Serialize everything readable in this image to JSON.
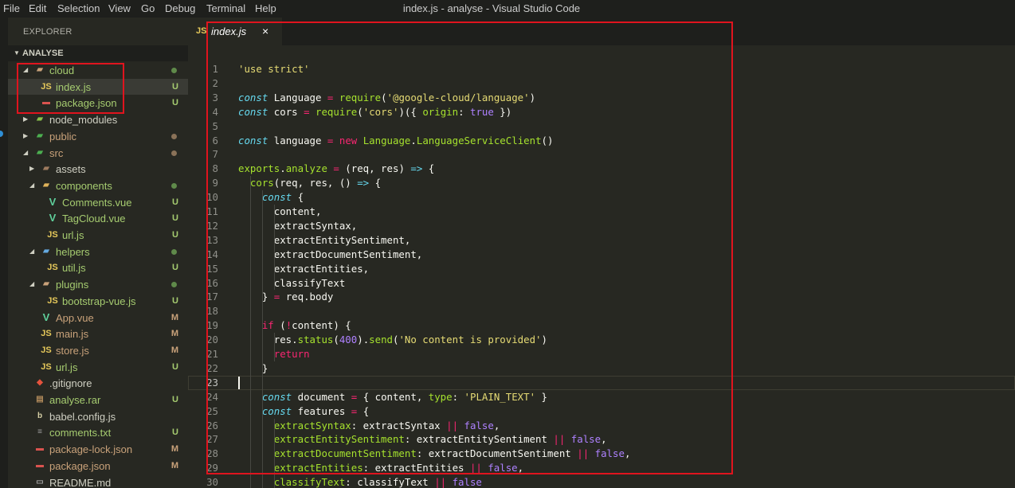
{
  "window": {
    "title": "index.js - analyse - Visual Studio Code"
  },
  "menu": [
    "File",
    "Edit",
    "Selection",
    "View",
    "Go",
    "Debug",
    "Terminal",
    "Help"
  ],
  "sidebar": {
    "title": "EXPLORER",
    "section": "ANALYSE",
    "tree": [
      {
        "name": "cloud",
        "kind": "folder",
        "depth": 1,
        "expanded": true,
        "icon": "folder-open-icon",
        "status": "dot",
        "color": "green"
      },
      {
        "name": "index.js",
        "kind": "js",
        "depth": 2,
        "icon": "js-file-icon",
        "status": "U",
        "color": "green",
        "selected": true
      },
      {
        "name": "package.json",
        "kind": "json",
        "depth": 2,
        "icon": "npm-file-icon",
        "status": "U",
        "color": "green"
      },
      {
        "name": "node_modules",
        "kind": "folder",
        "depth": 1,
        "expanded": false,
        "icon": "node-folder-icon",
        "status": "",
        "color": "white"
      },
      {
        "name": "public",
        "kind": "folder",
        "depth": 1,
        "expanded": false,
        "icon": "public-folder-icon",
        "status": "dot",
        "color": "brown"
      },
      {
        "name": "src",
        "kind": "folder",
        "depth": 1,
        "expanded": true,
        "icon": "src-folder-icon",
        "status": "dot",
        "color": "brown"
      },
      {
        "name": "assets",
        "kind": "folder",
        "depth": 2,
        "expanded": false,
        "icon": "assets-folder-icon",
        "status": "",
        "color": "white"
      },
      {
        "name": "components",
        "kind": "folder",
        "depth": 2,
        "expanded": true,
        "icon": "folder-open-icon",
        "status": "dot",
        "color": "green"
      },
      {
        "name": "Comments.vue",
        "kind": "vue",
        "depth": 3,
        "icon": "vue-file-icon",
        "status": "U",
        "color": "green"
      },
      {
        "name": "TagCloud.vue",
        "kind": "vue",
        "depth": 3,
        "icon": "vue-file-icon",
        "status": "U",
        "color": "green"
      },
      {
        "name": "url.js",
        "kind": "js",
        "depth": 3,
        "icon": "js-file-icon",
        "status": "U",
        "color": "green"
      },
      {
        "name": "helpers",
        "kind": "folder",
        "depth": 2,
        "expanded": true,
        "icon": "helpers-folder-icon",
        "status": "dot",
        "color": "green"
      },
      {
        "name": "util.js",
        "kind": "js",
        "depth": 3,
        "icon": "js-file-icon",
        "status": "U",
        "color": "green"
      },
      {
        "name": "plugins",
        "kind": "folder",
        "depth": 2,
        "expanded": true,
        "icon": "folder-open-icon",
        "status": "dot",
        "color": "green"
      },
      {
        "name": "bootstrap-vue.js",
        "kind": "js",
        "depth": 3,
        "icon": "js-file-icon",
        "status": "U",
        "color": "green"
      },
      {
        "name": "App.vue",
        "kind": "vue",
        "depth": 2,
        "icon": "vue-file-icon",
        "status": "M",
        "color": "brown"
      },
      {
        "name": "main.js",
        "kind": "js",
        "depth": 2,
        "icon": "js-file-icon",
        "status": "M",
        "color": "brown"
      },
      {
        "name": "store.js",
        "kind": "js",
        "depth": 2,
        "icon": "js-file-icon",
        "status": "M",
        "color": "brown"
      },
      {
        "name": "url.js",
        "kind": "js",
        "depth": 2,
        "icon": "js-file-icon",
        "status": "U",
        "color": "green"
      },
      {
        "name": ".gitignore",
        "kind": "git",
        "depth": 1,
        "icon": "git-file-icon",
        "status": "",
        "color": "white"
      },
      {
        "name": "analyse.rar",
        "kind": "archive",
        "depth": 1,
        "icon": "archive-file-icon",
        "status": "U",
        "color": "green"
      },
      {
        "name": "babel.config.js",
        "kind": "babel",
        "depth": 1,
        "icon": "babel-file-icon",
        "status": "",
        "color": "white"
      },
      {
        "name": "comments.txt",
        "kind": "txt",
        "depth": 1,
        "icon": "text-file-icon",
        "status": "U",
        "color": "green"
      },
      {
        "name": "package-lock.json",
        "kind": "json",
        "depth": 1,
        "icon": "npm-file-icon",
        "status": "M",
        "color": "brown"
      },
      {
        "name": "package.json",
        "kind": "json",
        "depth": 1,
        "icon": "npm-file-icon",
        "status": "M",
        "color": "brown"
      },
      {
        "name": "README.md",
        "kind": "md",
        "depth": 1,
        "icon": "markdown-file-icon",
        "status": "",
        "color": "white"
      }
    ]
  },
  "editor": {
    "tab": {
      "icon_label": "JS",
      "label": "index.js",
      "close": "×"
    },
    "active_line": 23,
    "lines": [
      [
        [
          "str",
          "'use strict'"
        ]
      ],
      [],
      [
        [
          "kw",
          "const"
        ],
        [
          "pl",
          " Language "
        ],
        [
          "op",
          "="
        ],
        [
          "pl",
          " "
        ],
        [
          "fn",
          "require"
        ],
        [
          "pl",
          "("
        ],
        [
          "str",
          "'@google-cloud/language'"
        ],
        [
          "pl",
          ")"
        ]
      ],
      [
        [
          "kw",
          "const"
        ],
        [
          "pl",
          " cors "
        ],
        [
          "op",
          "="
        ],
        [
          "pl",
          " "
        ],
        [
          "fn",
          "require"
        ],
        [
          "pl",
          "("
        ],
        [
          "str",
          "'cors'"
        ],
        [
          "pl",
          ")({ "
        ],
        [
          "fn",
          "origin"
        ],
        [
          "pl",
          ": "
        ],
        [
          "num",
          "true"
        ],
        [
          "pl",
          " })"
        ]
      ],
      [],
      [
        [
          "kw",
          "const"
        ],
        [
          "pl",
          " language "
        ],
        [
          "op",
          "="
        ],
        [
          "pl",
          " "
        ],
        [
          "kw2",
          "new"
        ],
        [
          "pl",
          " "
        ],
        [
          "fn",
          "Language"
        ],
        [
          "pl",
          "."
        ],
        [
          "fn",
          "LanguageServiceClient"
        ],
        [
          "pl",
          "()"
        ]
      ],
      [],
      [
        [
          "fn",
          "exports"
        ],
        [
          "pl",
          "."
        ],
        [
          "fn",
          "analyze"
        ],
        [
          "pl",
          " "
        ],
        [
          "op",
          "="
        ],
        [
          "pl",
          " (req, res) "
        ],
        [
          "kw",
          "=>"
        ],
        [
          "pl",
          " {"
        ]
      ],
      [
        [
          "pl",
          "  "
        ],
        [
          "fn",
          "cors"
        ],
        [
          "pl",
          "(req, res, () "
        ],
        [
          "kw",
          "=>"
        ],
        [
          "pl",
          " {"
        ]
      ],
      [
        [
          "pl",
          "    "
        ],
        [
          "kw",
          "const"
        ],
        [
          "pl",
          " {"
        ]
      ],
      [
        [
          "pl",
          "      content,"
        ]
      ],
      [
        [
          "pl",
          "      extractSyntax,"
        ]
      ],
      [
        [
          "pl",
          "      extractEntitySentiment,"
        ]
      ],
      [
        [
          "pl",
          "      extractDocumentSentiment,"
        ]
      ],
      [
        [
          "pl",
          "      extractEntities,"
        ]
      ],
      [
        [
          "pl",
          "      classifyText"
        ]
      ],
      [
        [
          "pl",
          "    } "
        ],
        [
          "op",
          "="
        ],
        [
          "pl",
          " req.body"
        ]
      ],
      [],
      [
        [
          "pl",
          "    "
        ],
        [
          "kw2",
          "if"
        ],
        [
          "pl",
          " ("
        ],
        [
          "op",
          "!"
        ],
        [
          "pl",
          "content) {"
        ]
      ],
      [
        [
          "pl",
          "      res."
        ],
        [
          "fn",
          "status"
        ],
        [
          "pl",
          "("
        ],
        [
          "num",
          "400"
        ],
        [
          "pl",
          ")."
        ],
        [
          "fn",
          "send"
        ],
        [
          "pl",
          "("
        ],
        [
          "str",
          "'No content is provided'"
        ],
        [
          "pl",
          ")"
        ]
      ],
      [
        [
          "pl",
          "      "
        ],
        [
          "kw2",
          "return"
        ]
      ],
      [
        [
          "pl",
          "    }"
        ]
      ],
      [],
      [
        [
          "pl",
          "    "
        ],
        [
          "kw",
          "const"
        ],
        [
          "pl",
          " document "
        ],
        [
          "op",
          "="
        ],
        [
          "pl",
          " { content, "
        ],
        [
          "fn",
          "type"
        ],
        [
          "pl",
          ": "
        ],
        [
          "str",
          "'PLAIN_TEXT'"
        ],
        [
          "pl",
          " }"
        ]
      ],
      [
        [
          "pl",
          "    "
        ],
        [
          "kw",
          "const"
        ],
        [
          "pl",
          " features "
        ],
        [
          "op",
          "="
        ],
        [
          "pl",
          " {"
        ]
      ],
      [
        [
          "pl",
          "      "
        ],
        [
          "fn",
          "extractSyntax"
        ],
        [
          "pl",
          ": extractSyntax "
        ],
        [
          "op",
          "||"
        ],
        [
          "pl",
          " "
        ],
        [
          "num",
          "false"
        ],
        [
          "pl",
          ","
        ]
      ],
      [
        [
          "pl",
          "      "
        ],
        [
          "fn",
          "extractEntitySentiment"
        ],
        [
          "pl",
          ": extractEntitySentiment "
        ],
        [
          "op",
          "||"
        ],
        [
          "pl",
          " "
        ],
        [
          "num",
          "false"
        ],
        [
          "pl",
          ","
        ]
      ],
      [
        [
          "pl",
          "      "
        ],
        [
          "fn",
          "extractDocumentSentiment"
        ],
        [
          "pl",
          ": extractDocumentSentiment "
        ],
        [
          "op",
          "||"
        ],
        [
          "pl",
          " "
        ],
        [
          "num",
          "false"
        ],
        [
          "pl",
          ","
        ]
      ],
      [
        [
          "pl",
          "      "
        ],
        [
          "fn",
          "extractEntities"
        ],
        [
          "pl",
          ": extractEntities "
        ],
        [
          "op",
          "||"
        ],
        [
          "pl",
          " "
        ],
        [
          "num",
          "false"
        ],
        [
          "pl",
          ","
        ]
      ],
      [
        [
          "pl",
          "      "
        ],
        [
          "fn",
          "classifyText"
        ],
        [
          "pl",
          ": classifyText "
        ],
        [
          "op",
          "||"
        ],
        [
          "pl",
          " "
        ],
        [
          "num",
          "false"
        ]
      ],
      [
        [
          "pl",
          "    }"
        ]
      ]
    ]
  },
  "colors": {
    "highlight_frame": "#e0141e",
    "status_untracked": "#a6cc70",
    "status_modified": "#c9a27a"
  }
}
